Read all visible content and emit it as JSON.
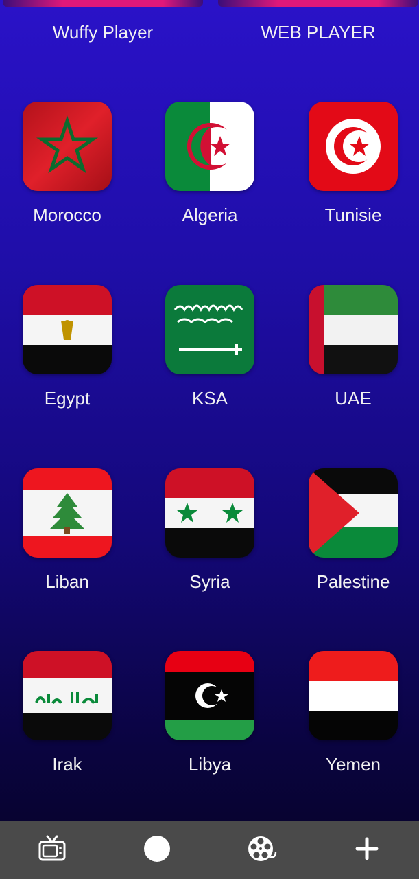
{
  "top_players": [
    {
      "label": "Wuffy Player"
    },
    {
      "label": "WEB PLAYER"
    }
  ],
  "countries": [
    {
      "name": "Morocco",
      "icon": "morocco-flag-icon"
    },
    {
      "name": "Algeria",
      "icon": "algeria-flag-icon"
    },
    {
      "name": "Tunisie",
      "icon": "tunisia-flag-icon"
    },
    {
      "name": "Egypt",
      "icon": "egypt-flag-icon"
    },
    {
      "name": "KSA",
      "icon": "saudi-arabia-flag-icon"
    },
    {
      "name": "UAE",
      "icon": "uae-flag-icon"
    },
    {
      "name": "Liban",
      "icon": "lebanon-flag-icon"
    },
    {
      "name": "Syria",
      "icon": "syria-flag-icon"
    },
    {
      "name": "Palestine",
      "icon": "palestine-flag-icon"
    },
    {
      "name": "Irak",
      "icon": "iraq-flag-icon"
    },
    {
      "name": "Libya",
      "icon": "libya-flag-icon"
    },
    {
      "name": "Yemen",
      "icon": "yemen-flag-icon"
    }
  ],
  "bottom_nav": [
    {
      "icon": "tv-icon"
    },
    {
      "icon": "circle-icon"
    },
    {
      "icon": "film-reel-icon"
    },
    {
      "icon": "plus-icon"
    }
  ],
  "colors": {
    "background_top": "#2a12c8",
    "background_bottom": "#060225",
    "nav_background": "#4a4a4a",
    "player_bar": "#e0187a"
  }
}
